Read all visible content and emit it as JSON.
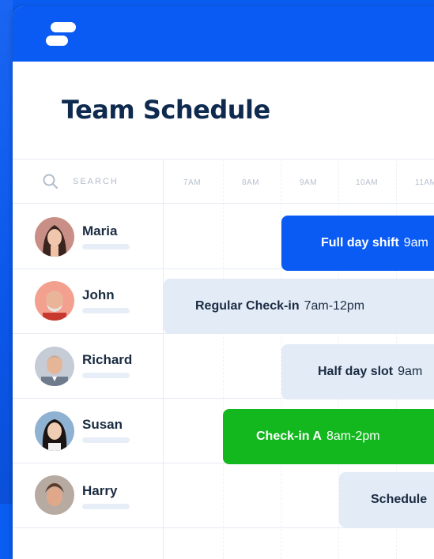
{
  "header": {
    "title": "Team Schedule"
  },
  "search": {
    "label": "SEARCH"
  },
  "timeline": {
    "hours": [
      "7AM",
      "8AM",
      "9AM",
      "10AM",
      "11AM"
    ]
  },
  "people": [
    {
      "name": "Maria",
      "shift_title": "Full day shift",
      "shift_time": "9am"
    },
    {
      "name": "John",
      "shift_title": "Regular Check-in",
      "shift_time": "7am-12pm"
    },
    {
      "name": "Richard",
      "shift_title": "Half day slot",
      "shift_time": "9am"
    },
    {
      "name": "Susan",
      "shift_title": "Check-in A",
      "shift_time": "8am-2pm"
    },
    {
      "name": "Harry",
      "shift_title": "Schedule",
      "shift_time": ""
    }
  ],
  "colors": {
    "brand_blue": "#0a5bf3",
    "light_shift": "#e3ebf6",
    "green_shift": "#12b81e",
    "title_text": "#0e2a4f"
  }
}
